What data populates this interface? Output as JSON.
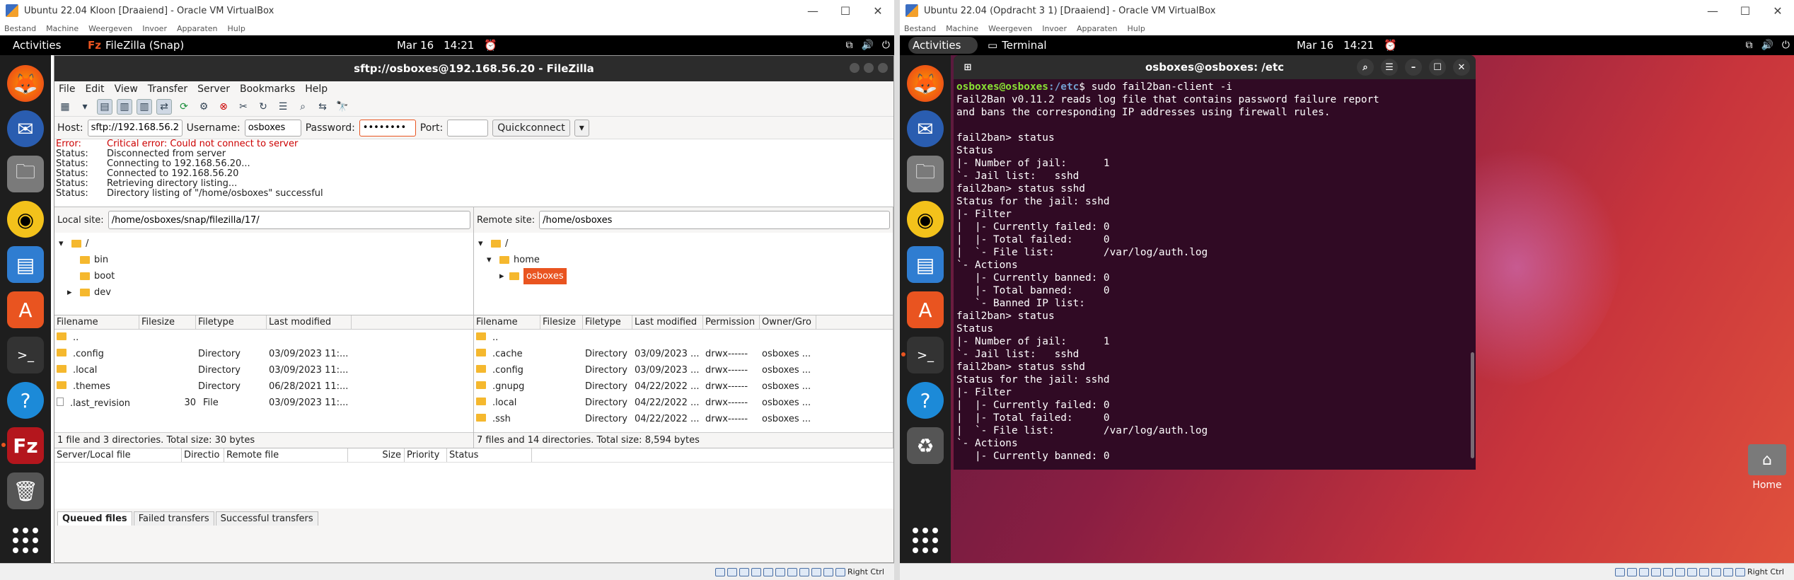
{
  "left_vm": {
    "title": "Ubuntu 22.04 Kloon [Draaiend] - Oracle VM VirtualBox",
    "vb_menu": [
      "Bestand",
      "Machine",
      "Weergeven",
      "Invoer",
      "Apparaten",
      "Hulp"
    ],
    "topbar": {
      "activities": "Activities",
      "app": "FileZilla (Snap)",
      "date": "Mar 16",
      "time": "14:21"
    },
    "status_host_key": "Right Ctrl",
    "filezilla": {
      "title": "sftp://osboxes@192.168.56.20 - FileZilla",
      "menu": [
        "File",
        "Edit",
        "View",
        "Transfer",
        "Server",
        "Bookmarks",
        "Help"
      ],
      "host_label": "Host:",
      "host_value": "sftp://192.168.56.2",
      "username_label": "Username:",
      "username_value": "osboxes",
      "password_label": "Password:",
      "password_value": "••••••••",
      "port_label": "Port:",
      "port_value": "",
      "quickconnect": "Quickconnect",
      "log": [
        {
          "k": "Error:",
          "v": "Critical error: Could not connect to server"
        },
        {
          "k": "Status:",
          "v": "Disconnected from server"
        },
        {
          "k": "Status:",
          "v": "Connecting to 192.168.56.20..."
        },
        {
          "k": "Status:",
          "v": "Connected to 192.168.56.20"
        },
        {
          "k": "Status:",
          "v": "Retrieving directory listing..."
        },
        {
          "k": "Status:",
          "v": "Directory listing of \"/home/osboxes\" successful"
        }
      ],
      "local_site_label": "Local site:",
      "local_site_value": "/home/osboxes/snap/filezilla/17/",
      "remote_site_label": "Remote site:",
      "remote_site_value": "/home/osboxes",
      "local_tree": [
        "/",
        "bin",
        "boot",
        "dev"
      ],
      "remote_tree": [
        "/",
        "home",
        "osboxes"
      ],
      "local_cols": [
        "Filename",
        "Filesize",
        "Filetype",
        "Last modified"
      ],
      "local_rows": [
        [
          "..",
          "",
          "",
          ""
        ],
        [
          ".config",
          "",
          "Directory",
          "03/09/2023 11:..."
        ],
        [
          ".local",
          "",
          "Directory",
          "03/09/2023 11:..."
        ],
        [
          ".themes",
          "",
          "Directory",
          "06/28/2021 11:..."
        ],
        [
          ".last_revision",
          "30",
          "File",
          "03/09/2023 11:..."
        ]
      ],
      "local_foot": "1 file and 3 directories. Total size: 30 bytes",
      "remote_cols": [
        "Filename",
        "Filesize",
        "Filetype",
        "Last modified",
        "Permission",
        "Owner/Gro"
      ],
      "remote_rows": [
        [
          "..",
          "",
          "",
          "",
          "",
          ""
        ],
        [
          ".cache",
          "",
          "Directory",
          "03/09/2023 ...",
          "drwx------",
          "osboxes ..."
        ],
        [
          ".config",
          "",
          "Directory",
          "03/09/2023 ...",
          "drwx------",
          "osboxes ..."
        ],
        [
          ".gnupg",
          "",
          "Directory",
          "04/22/2022 ...",
          "drwx------",
          "osboxes ..."
        ],
        [
          ".local",
          "",
          "Directory",
          "04/22/2022 ...",
          "drwx------",
          "osboxes ..."
        ],
        [
          ".ssh",
          "",
          "Directory",
          "04/22/2022 ...",
          "drwx------",
          "osboxes ..."
        ]
      ],
      "remote_foot": "7 files and 14 directories. Total size: 8,594 bytes",
      "queue_cols": [
        "Server/Local file",
        "Directio",
        "Remote file",
        "Size",
        "Priority",
        "Status"
      ],
      "tabs": [
        "Queued files",
        "Failed transfers",
        "Successful transfers"
      ]
    }
  },
  "right_vm": {
    "title": "Ubuntu 22.04 (Opdracht 3 1) [Draaiend] - Oracle VM VirtualBox",
    "vb_menu": [
      "Bestand",
      "Machine",
      "Weergeven",
      "Invoer",
      "Apparaten",
      "Hulp"
    ],
    "topbar": {
      "activities": "Activities",
      "app": "Terminal",
      "date": "Mar 16",
      "time": "14:21"
    },
    "status_host_key": "Right Ctrl",
    "terminal": {
      "title": "osboxes@osboxes: /etc",
      "prompt_user": "osboxes@osboxes",
      "prompt_path": ":/etc",
      "command": "$ sudo fail2ban-client -i",
      "lines": [
        "Fail2Ban v0.11.2 reads log file that contains password failure report",
        "and bans the corresponding IP addresses using firewall rules.",
        "",
        "fail2ban> status",
        "Status",
        "|- Number of jail:      1",
        "`- Jail list:   sshd",
        "fail2ban> status sshd",
        "Status for the jail: sshd",
        "|- Filter",
        "|  |- Currently failed: 0",
        "|  |- Total failed:     0",
        "|  `- File list:        /var/log/auth.log",
        "`- Actions",
        "   |- Currently banned: 0",
        "   |- Total banned:     0",
        "   `- Banned IP list:",
        "fail2ban> status",
        "Status",
        "|- Number of jail:      1",
        "`- Jail list:   sshd",
        "fail2ban> status sshd",
        "Status for the jail: sshd",
        "|- Filter",
        "|  |- Currently failed: 0",
        "|  |- Total failed:     0",
        "|  `- File list:        /var/log/auth.log",
        "`- Actions",
        "   |- Currently banned: 0"
      ]
    },
    "desktop_home_label": "Home"
  }
}
